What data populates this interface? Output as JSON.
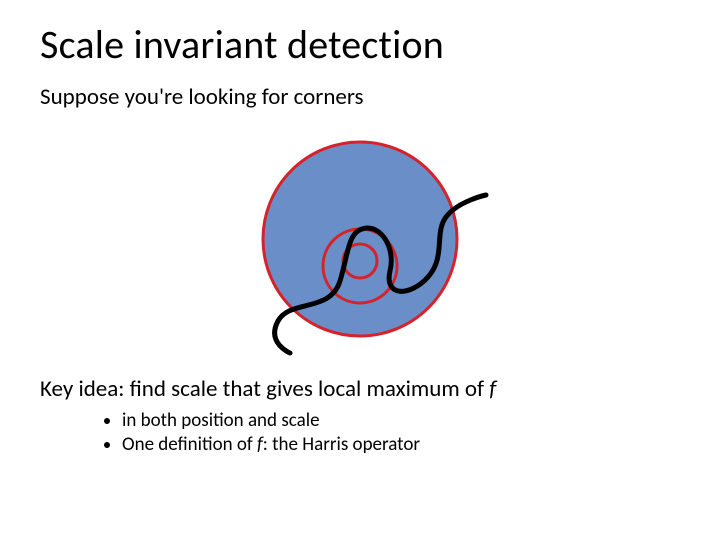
{
  "title": "Scale invariant detection",
  "subtitle": "Suppose you're looking for corners",
  "keyidea": {
    "prefix": "Key idea:  find scale that gives local maximum of ",
    "var": "f"
  },
  "bullets": [
    {
      "text": "in both position and scale"
    },
    {
      "prefix": "One definition of ",
      "var": "f",
      "suffix": ": the Harris operator"
    }
  ],
  "figure": {
    "large_fill": "#6a8fc8",
    "ring_stroke": "#d4232b",
    "curve_stroke": "#000000"
  }
}
